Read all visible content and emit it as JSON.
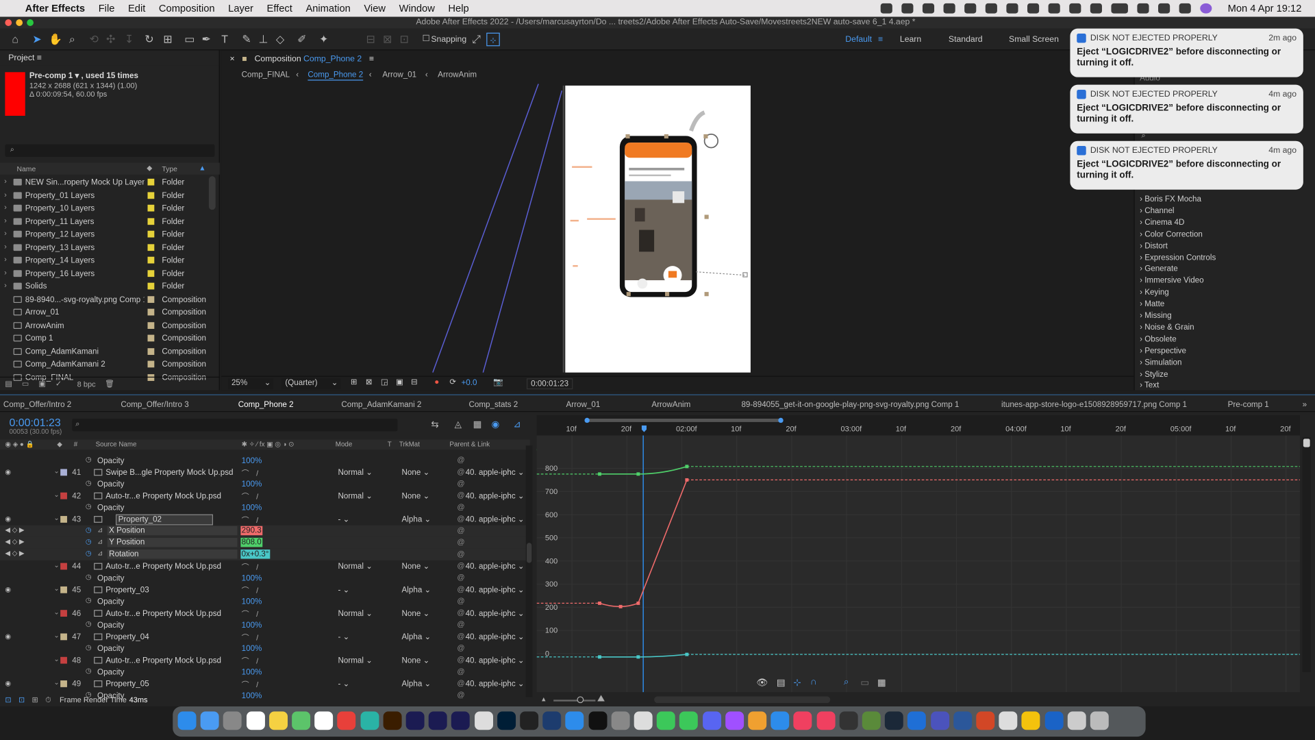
{
  "menubar": {
    "app": "After Effects",
    "items": [
      "File",
      "Edit",
      "Composition",
      "Layer",
      "Effect",
      "Animation",
      "View",
      "Window",
      "Help"
    ],
    "clock": "Mon 4 Apr  19:12"
  },
  "titlebar": {
    "title": "Adobe After Effects 2022 - /Users/marcusayrton/Do ... treets2/Adobe After Effects Auto-Save/Movestreets2NEW auto-save 6_1 4.aep *"
  },
  "toolbar": {
    "snapping": "Snapping",
    "workspaces": [
      "Default",
      "Learn",
      "Standard",
      "Small Screen"
    ]
  },
  "project": {
    "title": "Project",
    "selected": {
      "name": "Pre-comp 1 ▾ , used 15 times",
      "dims": "1242 x 2688  (621 x 1344) (1.00)",
      "duration": "Δ 0:00:09:54, 60.00 fps"
    },
    "columns": {
      "name": "Name",
      "type": "Type"
    },
    "items": [
      {
        "name": "NEW Sin...roperty Mock Up Layers",
        "type": "Folder"
      },
      {
        "name": "Property_01 Layers",
        "type": "Folder"
      },
      {
        "name": "Property_10 Layers",
        "type": "Folder"
      },
      {
        "name": "Property_11 Layers",
        "type": "Folder"
      },
      {
        "name": "Property_12 Layers",
        "type": "Folder"
      },
      {
        "name": "Property_13 Layers",
        "type": "Folder"
      },
      {
        "name": "Property_14 Layers",
        "type": "Folder"
      },
      {
        "name": "Property_16 Layers",
        "type": "Folder"
      },
      {
        "name": "Solids",
        "type": "Folder"
      },
      {
        "name": "89-8940...-svg-royalty.png Comp 1",
        "type": "Composition"
      },
      {
        "name": "Arrow_01",
        "type": "Composition"
      },
      {
        "name": "ArrowAnim",
        "type": "Composition"
      },
      {
        "name": "Comp 1",
        "type": "Composition"
      },
      {
        "name": "Comp_AdamKamani",
        "type": "Composition"
      },
      {
        "name": "Comp_AdamKamani 2",
        "type": "Composition"
      },
      {
        "name": "Comp_FINAL",
        "type": "Composition"
      }
    ],
    "bpc": "8 bpc"
  },
  "viewer": {
    "header": "Composition",
    "comp": "Comp_Phone 2",
    "breadcrumbs": [
      "Comp_FINAL",
      "Comp_Phone 2",
      "Arrow_01",
      "ArrowAnim"
    ],
    "zoom": "25%",
    "resolution": "(Quarter)",
    "exposure": "+0.0",
    "timecode": "0:00:01:23"
  },
  "notifications": [
    {
      "title": "DISK NOT EJECTED PROPERLY",
      "time": "2m ago",
      "body": "Eject “LOGICDRIVE2” before disconnecting or turning it off."
    },
    {
      "title": "DISK NOT EJECTED PROPERLY",
      "time": "4m ago",
      "body": "Eject “LOGICDRIVE2” before disconnecting or turning it off."
    },
    {
      "title": "DISK NOT EJECTED PROPERLY",
      "time": "4m ago",
      "body": "Eject “LOGICDRIVE2” before disconnecting or turning it off."
    }
  ],
  "effects": {
    "partial": "Audio",
    "items": [
      "Boris FX Mocha",
      "Channel",
      "Cinema 4D",
      "Color Correction",
      "Distort",
      "Expression Controls",
      "Generate",
      "Immersive Video",
      "Keying",
      "Matte",
      "Missing",
      "Noise & Grain",
      "Obsolete",
      "Perspective",
      "Simulation",
      "Stylize",
      "Text"
    ]
  },
  "timeline": {
    "tabs": [
      "Comp_Offer/Intro 2",
      "Comp_Offer/Intro 3",
      "Comp_Phone 2",
      "Comp_AdamKamani 2",
      "Comp_stats 2",
      "Arrow_01",
      "ArrowAnim",
      "89-894055_get-it-on-google-play-png-svg-royalty.png Comp 1",
      "itunes-app-store-logo-e1508928959717.png Comp 1",
      "Pre-comp 1"
    ],
    "timecode": "0:00:01:23",
    "frames": "00053 (30.00 fps)",
    "columns": {
      "num": "#",
      "src": "Source Name",
      "mode": "Mode",
      "t": "T",
      "trk": "TrkMat",
      "parent": "Parent & Link"
    },
    "rows": [
      {
        "kind": "prop",
        "label": "Opacity",
        "value": "100%"
      },
      {
        "kind": "layer",
        "num": "41",
        "name": "Swipe B...gle Property Mock Up.psd",
        "mode": "Normal",
        "trk": "None",
        "parent": "40. apple-iphc",
        "color": "#a9b0d6"
      },
      {
        "kind": "prop",
        "label": "Opacity",
        "value": "100%"
      },
      {
        "kind": "layer",
        "num": "42",
        "name": "Auto-tr...e Property Mock Up.psd",
        "mode": "Normal",
        "trk": "None",
        "parent": "40. apple-iphc",
        "color": "#c54040"
      },
      {
        "kind": "prop",
        "label": "Opacity",
        "value": "100%"
      },
      {
        "kind": "layer",
        "num": "43",
        "name": "Property_02",
        "mode": "-",
        "trk": "Alpha",
        "parent": "40. apple-iphc",
        "color": "#c5b48a"
      },
      {
        "kind": "xpos",
        "label": "X Position",
        "value": "290.3"
      },
      {
        "kind": "ypos",
        "label": "Y Position",
        "value": "808.0"
      },
      {
        "kind": "rot",
        "label": "Rotation",
        "value": "0x+0.3°"
      },
      {
        "kind": "layer",
        "num": "44",
        "name": "Auto-tr...e Property Mock Up.psd",
        "mode": "Normal",
        "trk": "None",
        "parent": "40. apple-iphc",
        "color": "#c54040"
      },
      {
        "kind": "prop",
        "label": "Opacity",
        "value": "100%"
      },
      {
        "kind": "layer",
        "num": "45",
        "name": "Property_03",
        "mode": "-",
        "trk": "Alpha",
        "parent": "40. apple-iphc",
        "color": "#c5b48a"
      },
      {
        "kind": "prop",
        "label": "Opacity",
        "value": "100%"
      },
      {
        "kind": "layer",
        "num": "46",
        "name": "Auto-tr...e Property Mock Up.psd",
        "mode": "Normal",
        "trk": "None",
        "parent": "40. apple-iphc",
        "color": "#c54040"
      },
      {
        "kind": "prop",
        "label": "Opacity",
        "value": "100%"
      },
      {
        "kind": "layer",
        "num": "47",
        "name": "Property_04",
        "mode": "-",
        "trk": "Alpha",
        "parent": "40. apple-iphc",
        "color": "#c5b48a"
      },
      {
        "kind": "prop",
        "label": "Opacity",
        "value": "100%"
      },
      {
        "kind": "layer",
        "num": "48",
        "name": "Auto-tr...e Property Mock Up.psd",
        "mode": "Normal",
        "trk": "None",
        "parent": "40. apple-iphc",
        "color": "#c54040"
      },
      {
        "kind": "prop",
        "label": "Opacity",
        "value": "100%"
      },
      {
        "kind": "layer",
        "num": "49",
        "name": "Property_05",
        "mode": "-",
        "trk": "Alpha",
        "parent": "40. apple-iphc",
        "color": "#c5b48a"
      },
      {
        "kind": "prop",
        "label": "Opacity",
        "value": "100%"
      }
    ],
    "ruler": [
      "10f",
      "20f",
      "02:00f",
      "10f",
      "20f",
      "03:00f",
      "10f",
      "20f",
      "04:00f",
      "10f",
      "20f",
      "05:00f",
      "10f",
      "20f"
    ],
    "graph_labels": [
      "800",
      "700",
      "600",
      "500",
      "400",
      "300",
      "200",
      "100",
      "0"
    ],
    "render_time_label": "Frame Render Time",
    "render_time": "43ms"
  },
  "colors": {
    "accent": "#2d8ceb",
    "xpos": "#f06b6b",
    "ypos": "#4fd06a",
    "rot": "#49c7c7"
  }
}
